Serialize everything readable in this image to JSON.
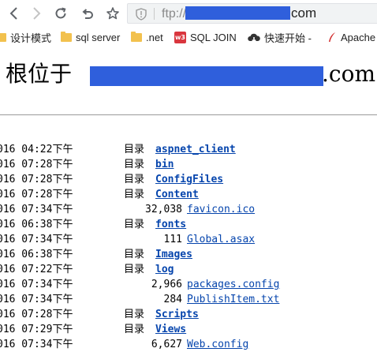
{
  "browser": {
    "url_prefix": "ftp://",
    "url_suffix": "com",
    "bookmarks": [
      {
        "label": "设计模式",
        "icon": "folder-icon"
      },
      {
        "label": "sql server",
        "icon": "folder-icon"
      },
      {
        "label": ".net",
        "icon": "folder-icon"
      },
      {
        "label": "SQL JOIN",
        "icon": "w3schools-icon"
      },
      {
        "label": "快速开始 -",
        "icon": "cloud-download-icon"
      },
      {
        "label": "Apache",
        "icon": "apache-feather-icon"
      }
    ]
  },
  "page": {
    "heading_prefix": "根位于",
    "heading_suffix": ".com",
    "dir_label": "目录",
    "entries": [
      {
        "date": "016 04:22下午",
        "is_dir": true,
        "size": "",
        "name": "aspnet_client"
      },
      {
        "date": "016 07:28下午",
        "is_dir": true,
        "size": "",
        "name": "bin"
      },
      {
        "date": "016 07:28下午",
        "is_dir": true,
        "size": "",
        "name": "ConfigFiles"
      },
      {
        "date": "016 07:28下午",
        "is_dir": true,
        "size": "",
        "name": "Content"
      },
      {
        "date": "016 07:34下午",
        "is_dir": false,
        "size": "32,038",
        "name": "favicon.ico"
      },
      {
        "date": "016 06:38下午",
        "is_dir": true,
        "size": "",
        "name": "fonts"
      },
      {
        "date": "016 07:34下午",
        "is_dir": false,
        "size": "111",
        "name": "Global.asax"
      },
      {
        "date": "016 06:38下午",
        "is_dir": true,
        "size": "",
        "name": "Images"
      },
      {
        "date": "016 07:22下午",
        "is_dir": true,
        "size": "",
        "name": "log"
      },
      {
        "date": "016 07:34下午",
        "is_dir": false,
        "size": "2,966",
        "name": "packages.config"
      },
      {
        "date": "016 07:34下午",
        "is_dir": false,
        "size": "284",
        "name": "PublishItem.txt"
      },
      {
        "date": "016 07:28下午",
        "is_dir": true,
        "size": "",
        "name": "Scripts"
      },
      {
        "date": "016 07:29下午",
        "is_dir": true,
        "size": "",
        "name": "Views"
      },
      {
        "date": "016 07:34下午",
        "is_dir": false,
        "size": "6,627",
        "name": "Web.config"
      }
    ]
  },
  "colors": {
    "link": "#0645ad",
    "redaction": "#2f5fdc"
  }
}
